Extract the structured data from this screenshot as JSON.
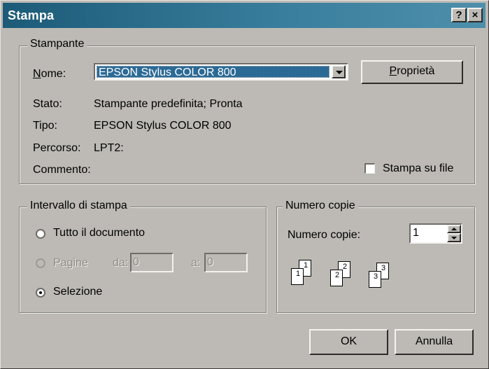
{
  "window": {
    "title": "Stampa",
    "help_button": "?",
    "close_button": "×"
  },
  "printer_group": {
    "legend": "Stampante",
    "name_label": "Nome:",
    "name_value": "EPSON Stylus COLOR 800",
    "properties_button": "Proprietà",
    "status_label": "Stato:",
    "status_value": "Stampante predefinita; Pronta",
    "type_label": "Tipo:",
    "type_value": "EPSON Stylus COLOR 800",
    "path_label": "Percorso:",
    "path_value": "LPT2:",
    "comment_label": "Commento:",
    "print_to_file_label": "Stampa su file",
    "print_to_file_checked": false
  },
  "range_group": {
    "legend": "Intervallo di stampa",
    "all_label": "Tutto il documento",
    "pages_label": "Pagine",
    "from_label": "da:",
    "from_value": "0",
    "to_label": "a:",
    "to_value": "0",
    "selection_label": "Selezione",
    "selected_option": "Selezione"
  },
  "copies_group": {
    "legend": "Numero copie",
    "copies_label": "Numero copie:",
    "copies_value": "1",
    "collate_pages": [
      "1",
      "1",
      "2",
      "2",
      "3",
      "3"
    ]
  },
  "buttons": {
    "ok": "OK",
    "cancel": "Annulla"
  },
  "colors": {
    "title_bar": "#1c5b78",
    "selection_highlight": "#2c6a96",
    "dialog_face": "#bdbab5"
  }
}
